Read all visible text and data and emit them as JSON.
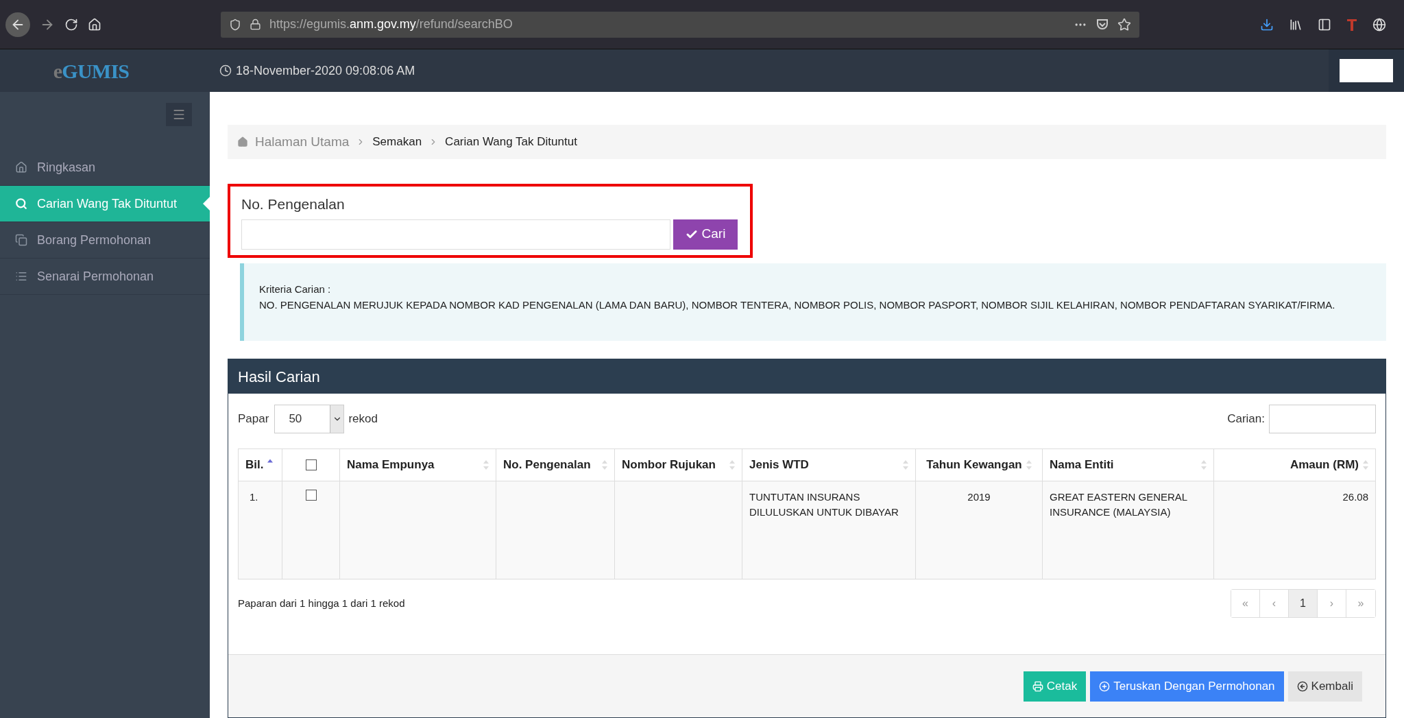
{
  "browser": {
    "url": {
      "scheme": "https://egumis.",
      "domain": "anm.gov.my",
      "path": "/refund/searchBO"
    }
  },
  "header": {
    "logo": {
      "prefix": "e",
      "main": "GUMIS"
    },
    "datetime": "18-November-2020 09:08:06 AM"
  },
  "sidebar": {
    "items": [
      {
        "label": "Ringkasan",
        "selected": false
      },
      {
        "label": "Carian Wang Tak Dituntut",
        "selected": true
      },
      {
        "label": "Borang Permohonan",
        "selected": false
      },
      {
        "label": "Senarai Permohonan",
        "selected": false
      }
    ]
  },
  "breadcrumb": [
    {
      "label": "Halaman Utama",
      "kind": "home"
    },
    {
      "label": "Semakan",
      "kind": "link"
    },
    {
      "label": "Carian Wang Tak Dituntut",
      "kind": "current"
    }
  ],
  "search": {
    "label": "No. Pengenalan",
    "button": "Cari"
  },
  "info": {
    "title": "Kriteria Carian :",
    "text": "NO. PENGENALAN MERUJUK KEPADA NOMBOR KAD PENGENALAN (LAMA DAN BARU), NOMBOR TENTERA, NOMBOR POLIS, NOMBOR PASPORT, NOMBOR SIJIL KELAHIRAN, NOMBOR PENDAFTARAN SYARIKAT/FIRMA."
  },
  "results": {
    "title": "Hasil Carian",
    "show_label": "Papar",
    "page_size": "50",
    "show_suffix": "rekod",
    "search_label": "Carian:",
    "columns": [
      {
        "label": "Bil.",
        "kind": "text",
        "sorted": true
      },
      {
        "kind": "checkbox",
        "checked": false
      },
      {
        "label": "Nama Empunya",
        "kind": "text",
        "sorted": false
      },
      {
        "label": "No. Pengenalan",
        "kind": "text",
        "sorted": false
      },
      {
        "label": "Nombor Rujukan",
        "kind": "text",
        "sorted": false
      },
      {
        "label": "Jenis WTD",
        "kind": "text",
        "sorted": false
      },
      {
        "label": "Tahun Kewangan",
        "kind": "year",
        "sorted": false
      },
      {
        "label": "Nama Entiti",
        "kind": "text",
        "sorted": false
      },
      {
        "label": "Amaun (RM)",
        "kind": "amount",
        "sorted": false
      }
    ],
    "rows": [
      {
        "checked": false,
        "cells": [
          "1.",
          "",
          "",
          "",
          "",
          "TUNTUTAN INSURANS DILULUSKAN UNTUK DIBAYAR",
          "2019",
          "GREAT EASTERN GENERAL INSURANCE (MALAYSIA)",
          "26.08"
        ]
      }
    ],
    "summary": "Paparan dari 1 hingga 1 dari 1 rekod",
    "pages": [
      {
        "label": "«",
        "selected": false
      },
      {
        "label": "‹",
        "selected": false
      },
      {
        "label": "1",
        "selected": true
      },
      {
        "label": "›",
        "selected": false
      },
      {
        "label": "»",
        "selected": false
      }
    ],
    "actions": [
      {
        "label": "Cetak",
        "kind": "print"
      },
      {
        "label": "Teruskan Dengan Permohonan",
        "kind": "proceed"
      },
      {
        "label": "Kembali",
        "kind": "back"
      }
    ]
  }
}
